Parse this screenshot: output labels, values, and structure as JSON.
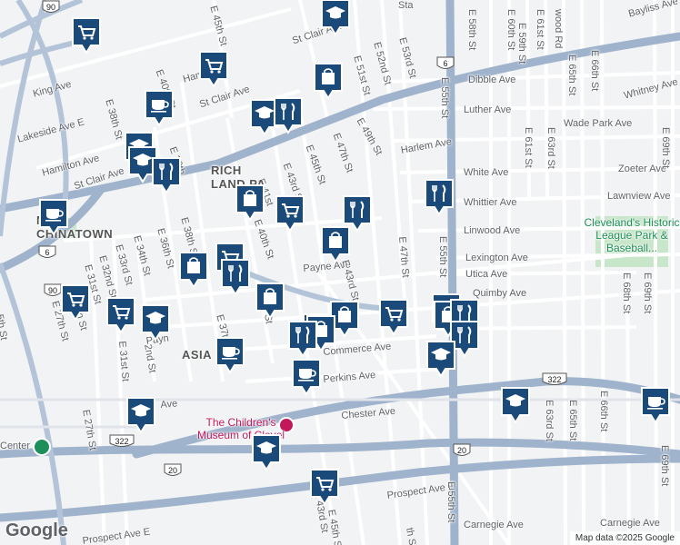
{
  "attribution": "Map data ©2025 Google",
  "logo": "Google",
  "areas": [
    {
      "id": "chinatown",
      "text": "NE\nCHINATOWN"
    },
    {
      "id": "asiatown",
      "text": "ASIA"
    },
    {
      "id": "richland",
      "text": "RICH\nLAND PA"
    }
  ],
  "parks": [
    {
      "id": "league-park",
      "text": "Cleveland's Historic League Park & Baseball..."
    }
  ],
  "pois": [
    {
      "id": "childrens-museum",
      "text": "The Children's Museum of Clevel"
    }
  ],
  "streets": [
    {
      "id": "st-clair-1",
      "text": "St Clair Ave"
    },
    {
      "id": "st-clair-2",
      "text": "St Clair Ave"
    },
    {
      "id": "st-clair-3",
      "text": "St Clair Ave"
    },
    {
      "id": "king",
      "text": "King Ave"
    },
    {
      "id": "lakeside",
      "text": "Lakeside Ave E"
    },
    {
      "id": "hamilton",
      "text": "Hamilton Ave"
    },
    {
      "id": "hamilton-2",
      "text": "Ham"
    },
    {
      "id": "dibble",
      "text": "Dibble Ave"
    },
    {
      "id": "luther",
      "text": "Luther Ave"
    },
    {
      "id": "harlem",
      "text": "Harlem Ave"
    },
    {
      "id": "white",
      "text": "White Ave"
    },
    {
      "id": "whittier",
      "text": "Whittier Ave"
    },
    {
      "id": "linwood",
      "text": "Linwood Ave"
    },
    {
      "id": "lexington",
      "text": "Lexington Ave"
    },
    {
      "id": "utica",
      "text": "Utica Ave"
    },
    {
      "id": "quimby",
      "text": "Quimby Ave"
    },
    {
      "id": "payne",
      "text": "Payne Ave"
    },
    {
      "id": "payne-2",
      "text": "Payn"
    },
    {
      "id": "commerce",
      "text": "Commerce Ave"
    },
    {
      "id": "perkins",
      "text": "Perkins Ave"
    },
    {
      "id": "chester",
      "text": "Chester Ave"
    },
    {
      "id": "chester-ave-stub",
      "text": "Ave"
    },
    {
      "id": "prospect",
      "text": "Prospect Ave E"
    },
    {
      "id": "prospect-2",
      "text": "Prospect Ave E"
    },
    {
      "id": "carnegie-1",
      "text": "Carnegie Ave"
    },
    {
      "id": "carnegie-2",
      "text": "Carnegie Ave"
    },
    {
      "id": "wade-park",
      "text": "Wade Park Ave"
    },
    {
      "id": "zoeter",
      "text": "Zoeter Ave"
    },
    {
      "id": "lawnview",
      "text": "Lawnview Ave"
    },
    {
      "id": "whitney",
      "text": "Whitney Ave"
    },
    {
      "id": "bayliss",
      "text": "Bayliss Ave"
    },
    {
      "id": "e55-1",
      "text": "E 55th St"
    },
    {
      "id": "e55-2",
      "text": "E 55th St"
    },
    {
      "id": "e55-3",
      "text": "E 55th St"
    },
    {
      "id": "e53",
      "text": "E 53rd St"
    },
    {
      "id": "e52",
      "text": "E 52nd St"
    },
    {
      "id": "e51",
      "text": "E 51st St"
    },
    {
      "id": "e49",
      "text": "E 49th St"
    },
    {
      "id": "e47-1",
      "text": "E 47th St"
    },
    {
      "id": "e47-2",
      "text": "E 47th St"
    },
    {
      "id": "e45-1",
      "text": "E 45th St"
    },
    {
      "id": "e45-2",
      "text": "E 45th St"
    },
    {
      "id": "e43-1",
      "text": "E 43rd St"
    },
    {
      "id": "e43-2",
      "text": "E 43rd St"
    },
    {
      "id": "e43-3",
      "text": "E 43rd St"
    },
    {
      "id": "e41",
      "text": "E 41st"
    },
    {
      "id": "e40-1",
      "text": "E 40th St"
    },
    {
      "id": "e40-2",
      "text": "E 40th St"
    },
    {
      "id": "e39",
      "text": "E 39th"
    },
    {
      "id": "e38-1",
      "text": "E 38th St"
    },
    {
      "id": "e38-2",
      "text": "E 38th St"
    },
    {
      "id": "e37",
      "text": "E 37th"
    },
    {
      "id": "e36",
      "text": "E 36th St"
    },
    {
      "id": "e34",
      "text": "E 34th St"
    },
    {
      "id": "e33",
      "text": "E 33rd St"
    },
    {
      "id": "e32",
      "text": "E 32nd St"
    },
    {
      "id": "e31-1",
      "text": "E 31st St"
    },
    {
      "id": "e31-2",
      "text": "E 31st St"
    },
    {
      "id": "e30",
      "text": "th St"
    },
    {
      "id": "e27-1",
      "text": "E 27th St"
    },
    {
      "id": "e27-2",
      "text": "E 27th St"
    },
    {
      "id": "e25",
      "text": "5th St"
    },
    {
      "id": "e22",
      "text": "2nd St"
    },
    {
      "id": "e36-2",
      "text": "St"
    },
    {
      "id": "e55-prospect",
      "text": "th St"
    },
    {
      "id": "e58",
      "text": "E 58th St"
    },
    {
      "id": "e59",
      "text": "E 59th St"
    },
    {
      "id": "e60",
      "text": "E 60th St"
    },
    {
      "id": "e61-1",
      "text": "E 61st St"
    },
    {
      "id": "e61-2",
      "text": "E 61st St"
    },
    {
      "id": "e63-1",
      "text": "E 63rd St"
    },
    {
      "id": "e63-2",
      "text": "E 63rd St"
    },
    {
      "id": "e65-1",
      "text": "E 65th St"
    },
    {
      "id": "e65-2",
      "text": "E 65th St"
    },
    {
      "id": "e66-1",
      "text": "E 66th St"
    },
    {
      "id": "e66-2",
      "text": "E 66th St"
    },
    {
      "id": "e68",
      "text": "E 68th St"
    },
    {
      "id": "e69-1",
      "text": "E 69th St"
    },
    {
      "id": "e69-2",
      "text": "E 69th St"
    },
    {
      "id": "e69-3",
      "text": "E 69th St"
    },
    {
      "id": "e45-top",
      "text": "E 45th St"
    },
    {
      "id": "wood-rd",
      "text": "wood Rd"
    },
    {
      "id": "st-label",
      "text": "Sta"
    },
    {
      "id": "center",
      "text": "Center"
    }
  ],
  "highway_shields": [
    {
      "id": "us6-a",
      "text": "6"
    },
    {
      "id": "us6-b",
      "text": "6"
    },
    {
      "id": "us20-a",
      "text": "20"
    },
    {
      "id": "us20-b",
      "text": "20"
    },
    {
      "id": "us322-a",
      "text": "322"
    },
    {
      "id": "us322-b",
      "text": "322"
    },
    {
      "id": "i90-a",
      "text": "90"
    },
    {
      "id": "i90-b",
      "text": "90"
    }
  ],
  "markers": [
    {
      "type": "grocery",
      "icon": "shopping-cart-icon"
    },
    {
      "type": "grocery",
      "icon": "shopping-cart-icon"
    },
    {
      "type": "school",
      "icon": "graduation-cap-icon"
    },
    {
      "type": "shopping",
      "icon": "shopping-bag-icon"
    },
    {
      "type": "cafe",
      "icon": "coffee-cup-icon"
    },
    {
      "type": "school",
      "icon": "graduation-cap-icon"
    },
    {
      "type": "restaurant",
      "icon": "fork-knife-icon"
    },
    {
      "type": "school",
      "icon": "graduation-cap-icon"
    },
    {
      "type": "school",
      "icon": "graduation-cap-icon"
    },
    {
      "type": "restaurant",
      "icon": "fork-knife-icon"
    },
    {
      "type": "shopping",
      "icon": "shopping-bag-icon"
    },
    {
      "type": "grocery",
      "icon": "shopping-cart-icon"
    },
    {
      "type": "restaurant",
      "icon": "fork-knife-icon"
    },
    {
      "type": "restaurant",
      "icon": "fork-knife-icon"
    },
    {
      "type": "cafe",
      "icon": "coffee-cup-icon"
    },
    {
      "type": "shopping",
      "icon": "shopping-bag-icon"
    },
    {
      "type": "grocery",
      "icon": "shopping-cart-icon"
    },
    {
      "type": "restaurant",
      "icon": "fork-knife-icon"
    },
    {
      "type": "shopping",
      "icon": "shopping-bag-icon"
    },
    {
      "type": "shopping",
      "icon": "shopping-bag-icon"
    },
    {
      "type": "grocery",
      "icon": "shopping-cart-icon"
    },
    {
      "type": "grocery",
      "icon": "shopping-cart-icon"
    },
    {
      "type": "school",
      "icon": "graduation-cap-icon"
    },
    {
      "type": "shopping",
      "icon": "shopping-bag-icon"
    },
    {
      "type": "restaurant",
      "icon": "fork-knife-icon"
    },
    {
      "type": "shopping",
      "icon": "shopping-bag-icon"
    },
    {
      "type": "grocery",
      "icon": "shopping-cart-icon"
    },
    {
      "type": "school",
      "icon": "graduation-cap-icon"
    },
    {
      "type": "shopping",
      "icon": "shopping-bag-icon"
    },
    {
      "type": "restaurant",
      "icon": "fork-knife-icon"
    },
    {
      "type": "restaurant",
      "icon": "fork-knife-icon"
    },
    {
      "type": "restaurant",
      "icon": "fork-knife-icon"
    },
    {
      "type": "school",
      "icon": "graduation-cap-icon"
    },
    {
      "type": "cafe",
      "icon": "coffee-cup-icon"
    },
    {
      "type": "cafe",
      "icon": "coffee-cup-icon"
    },
    {
      "type": "school",
      "icon": "graduation-cap-icon"
    },
    {
      "type": "cafe",
      "icon": "coffee-cup-icon"
    },
    {
      "type": "school",
      "icon": "graduation-cap-icon"
    },
    {
      "type": "school",
      "icon": "graduation-cap-icon"
    },
    {
      "type": "grocery",
      "icon": "shopping-cart-icon"
    }
  ],
  "colors": {
    "marker_fill": "#1a4a7a",
    "marker_border": "#ffffff",
    "road_major": "#8fa8c8",
    "road_minor": "#ffffff",
    "background": "#f1f3f4",
    "park": "#c8e6c9"
  }
}
